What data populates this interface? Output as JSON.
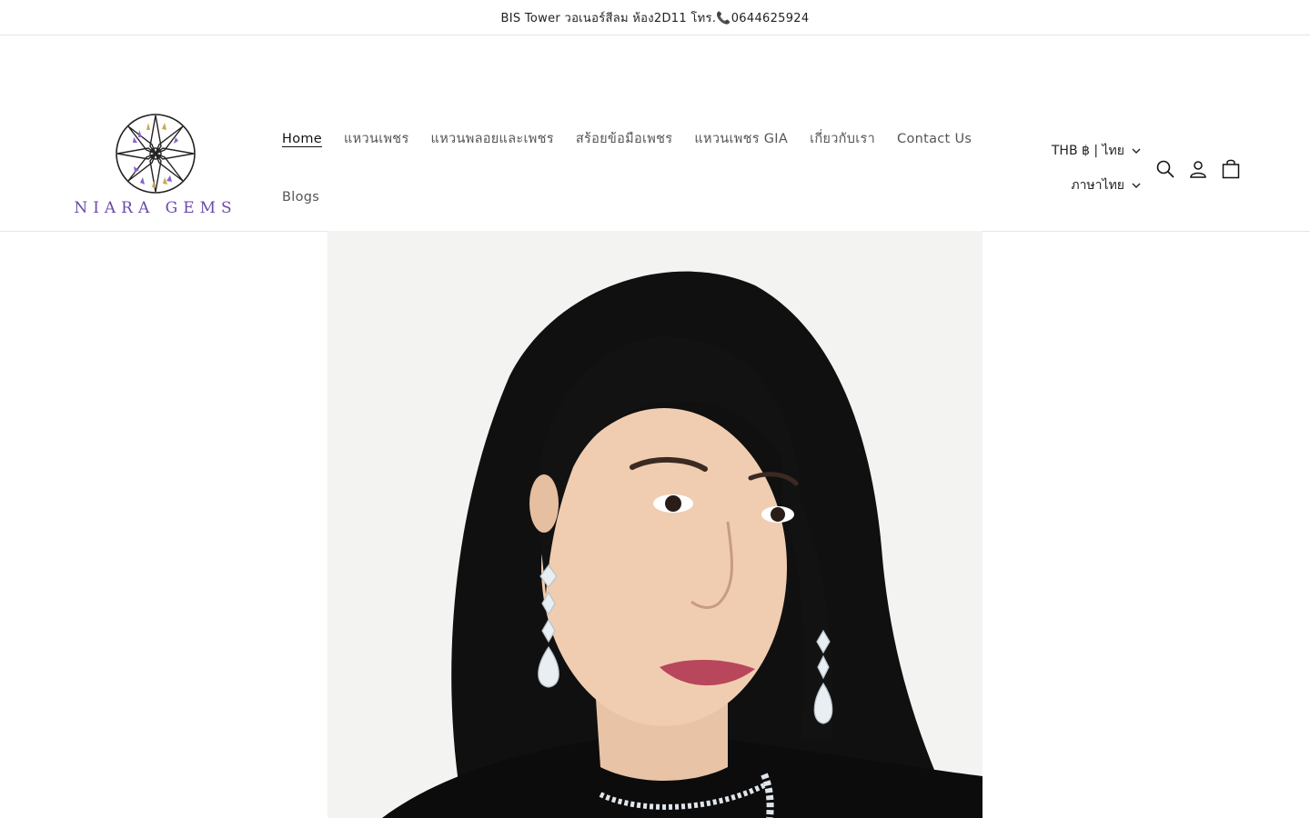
{
  "announcement": {
    "text": "BIS Tower วอเนอร์สีลม ห้อง2D11 โทร.📞0644625924"
  },
  "brand": {
    "name": "NIARA GEMS",
    "colors": {
      "purple": "#6a4aa8",
      "gold": "#c9a84a",
      "dark": "#222222"
    }
  },
  "nav": {
    "items": [
      {
        "label": "Home",
        "active": true
      },
      {
        "label": "แหวนเพชร"
      },
      {
        "label": "แหวนพลอยและเพชร"
      },
      {
        "label": "สร้อยข้อมือเพชร"
      },
      {
        "label": "แหวนเพชร GIA"
      },
      {
        "label": "เกี่ยวกับเรา"
      },
      {
        "label": "Contact Us"
      },
      {
        "label": "Blogs"
      }
    ]
  },
  "localization": {
    "currency": "THB ฿ | ไทย",
    "language": "ภาษาไทย"
  },
  "icons": {
    "search": "search-icon",
    "account": "account-icon",
    "cart": "cart-icon"
  },
  "hero": {
    "image": "model wearing diamond drop earrings and necklace"
  }
}
